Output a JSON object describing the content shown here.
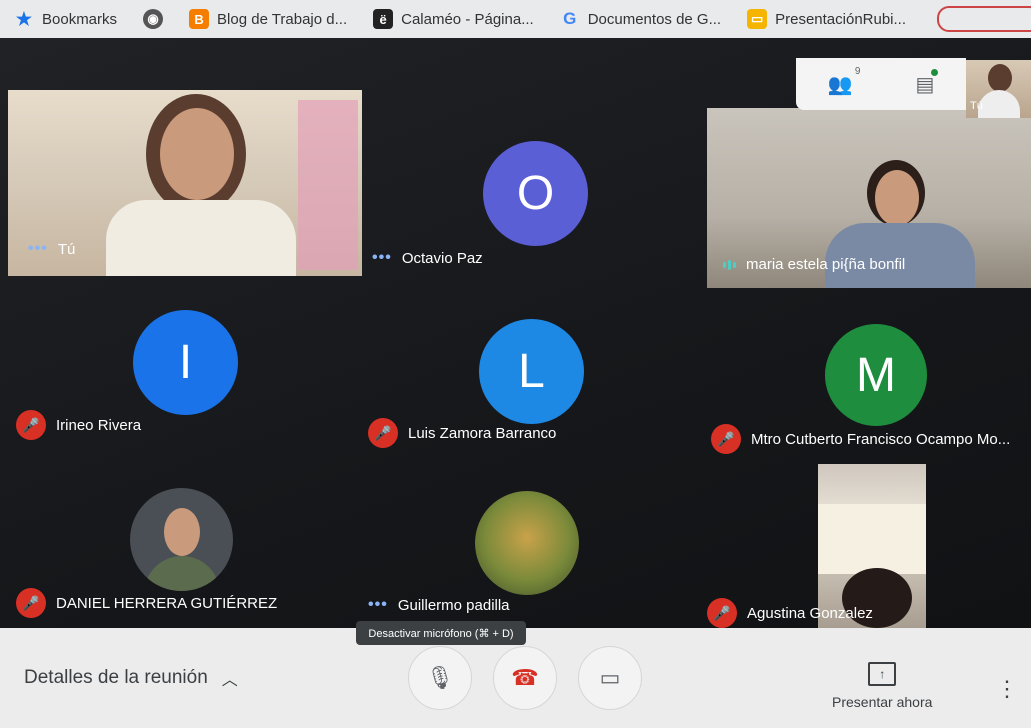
{
  "bookmarks": [
    {
      "label": "Bookmarks",
      "icon": "star-icon"
    },
    {
      "label": "",
      "icon": "globe-icon"
    },
    {
      "label": "Blog de Trabajo d...",
      "icon": "blogger-icon"
    },
    {
      "label": "Calaméo - Página...",
      "icon": "calameo-icon"
    },
    {
      "label": "Documentos de G...",
      "icon": "google-icon"
    },
    {
      "label": "PresentaciónRubi...",
      "icon": "slides-icon"
    }
  ],
  "participants": {
    "you": {
      "name": "Tú"
    },
    "octavio": {
      "name": "Octavio Paz",
      "initial": "O",
      "color": "#5b5fd6"
    },
    "maria": {
      "name": "maria estela pi{ña bonfil"
    },
    "ireneo": {
      "name": "Irineo Rivera",
      "initial": "I",
      "color": "#1a73e8"
    },
    "luis": {
      "name": "Luis Zamora Barranco",
      "initial": "L",
      "color": "#1e88e5"
    },
    "mtro": {
      "name": "Mtro Cutberto Francisco Ocampo Mo...",
      "initial": "M",
      "color": "#1e8e3e"
    },
    "daniel": {
      "name": "DANIEL HERRERA GUTIÉRREZ"
    },
    "guillermo": {
      "name": "Guillermo padilla"
    },
    "agustina": {
      "name": "Agustina Gonzalez"
    }
  },
  "panel": {
    "people_badge": "9",
    "selfview_label": "Tú"
  },
  "tooltip": "Desactivar micrófono (⌘ + D)",
  "bottom": {
    "details_label": "Detalles de la reunión",
    "present_label": "Presentar ahora"
  }
}
